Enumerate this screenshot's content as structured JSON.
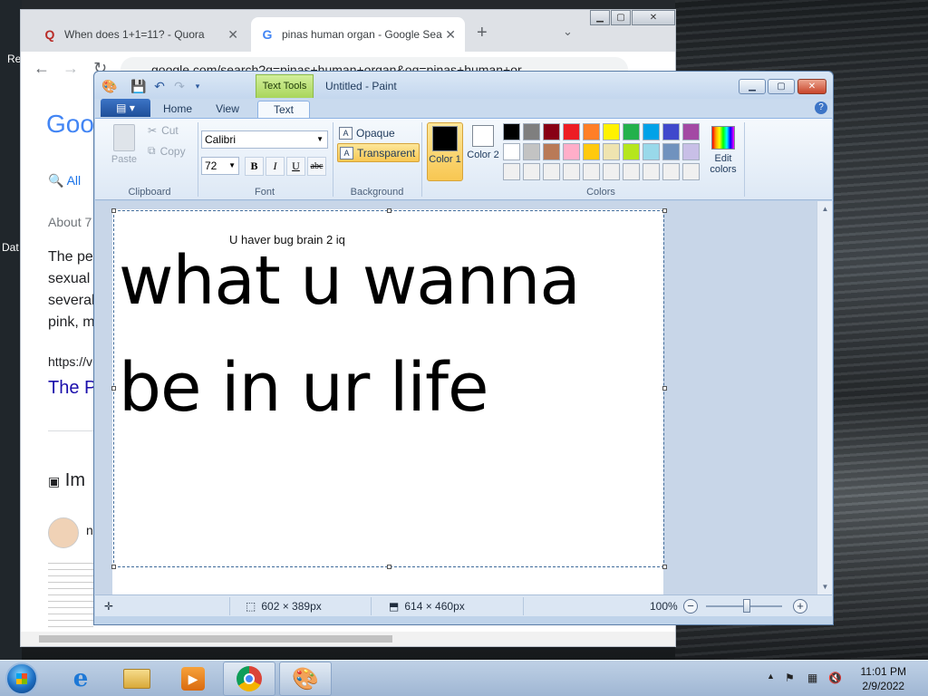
{
  "desktop": {
    "label_re": "Re",
    "label_dat": "Dat"
  },
  "chrome": {
    "tabs": [
      {
        "label": "When does 1+1=11? - Quora",
        "favicon": "Q"
      },
      {
        "label": "pinas human organ - Google Sea",
        "favicon": "G"
      }
    ],
    "url": "google.com/search?q=pinas+human+organ&oq=pinas+human+or...",
    "logo": "Goo",
    "all_tab": "All",
    "results_count": "About 7",
    "snippet_lines": [
      "The pe",
      "sexual",
      "several",
      "pink, m"
    ],
    "result_url": "https://v",
    "result_title": "The P",
    "images_heading": "Im",
    "avatar_text": "n"
  },
  "paint": {
    "title": "Untitled - Paint",
    "context_tab": "Text Tools",
    "tabs": {
      "home": "Home",
      "view": "View",
      "text": "Text"
    },
    "clipboard": {
      "paste": "Paste",
      "cut": "Cut",
      "copy": "Copy",
      "label": "Clipboard"
    },
    "font": {
      "family": "Calibri",
      "size": "72",
      "bold": "B",
      "italic": "I",
      "underline": "U",
      "strike": "abc",
      "label": "Font"
    },
    "background": {
      "opaque": "Opaque",
      "transparent": "Transparent",
      "label": "Background"
    },
    "colors": {
      "color1_label": "Color 1",
      "color2_label": "Color 2",
      "edit_label": "Edit colors",
      "label": "Colors",
      "color1": "#000000",
      "color2": "#ffffff",
      "palette": [
        "#000000",
        "#7f7f7f",
        "#880015",
        "#ed1c24",
        "#ff7f27",
        "#fff200",
        "#22b14c",
        "#00a2e8",
        "#3f48cc",
        "#a349a4",
        "#ffffff",
        "#c3c3c3",
        "#b97a57",
        "#ffaec9",
        "#ffc90e",
        "#efe4b0",
        "#b5e61d",
        "#99d9ea",
        "#7092be",
        "#c8bfe7",
        "#f0f0f0",
        "#f0f0f0",
        "#f0f0f0",
        "#f0f0f0",
        "#f0f0f0",
        "#f0f0f0",
        "#f0f0f0",
        "#f0f0f0",
        "#f0f0f0",
        "#f0f0f0"
      ]
    },
    "canvas": {
      "small_text": "U haver bug brain 2 iq",
      "big_line1": "what u wanna",
      "big_line2": "be in ur life"
    },
    "status": {
      "selection_size": "602 × 389px",
      "image_size": "614 × 460px",
      "zoom": "100%"
    }
  },
  "taskbar": {
    "time": "11:01 PM",
    "date": "2/9/2022"
  }
}
